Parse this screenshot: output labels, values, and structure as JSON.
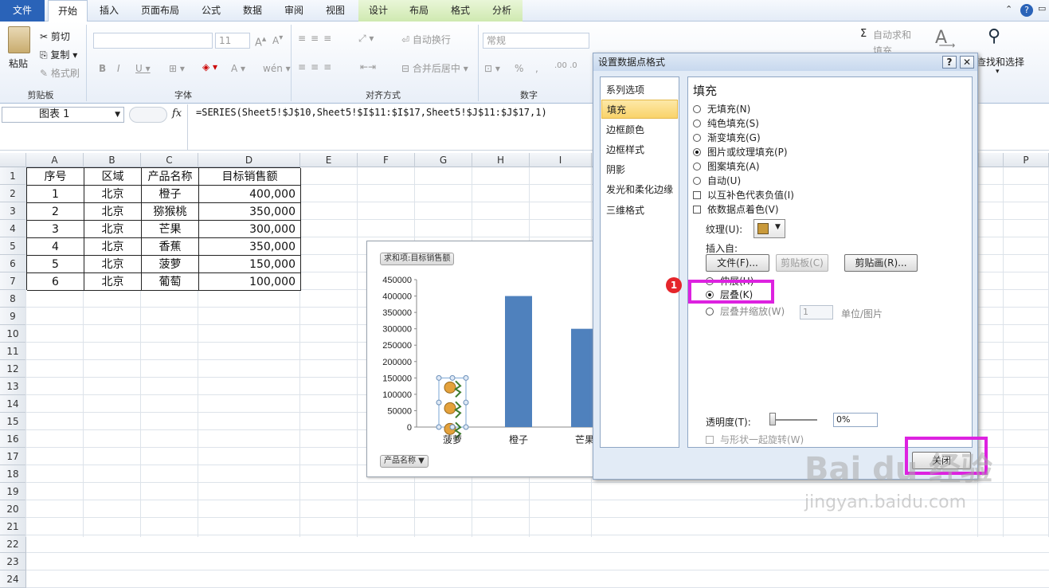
{
  "tabs": [
    "文件",
    "开始",
    "插入",
    "页面布局",
    "公式",
    "数据",
    "审阅",
    "视图",
    "设计",
    "布局",
    "格式",
    "分析"
  ],
  "ribbon": {
    "clipboard": {
      "paste": "粘贴",
      "cut": "剪切",
      "copy": "复制",
      "format_painter": "格式刷",
      "label": "剪贴板"
    },
    "font": {
      "size": "11",
      "label": "字体"
    },
    "alignment": {
      "wrap": "自动换行",
      "merge": "合并后居中",
      "label": "对齐方式"
    },
    "number": {
      "format": "常规",
      "label": "数字"
    },
    "editing": {
      "autosum": "自动求和",
      "fill": "填充",
      "find": "查找和选择"
    }
  },
  "formula_bar": {
    "name_box": "图表 1",
    "fx": "fx",
    "formula": "=SERIES(Sheet5!$J$10,Sheet5!$I$11:$I$17,Sheet5!$J$11:$J$17,1)"
  },
  "columns": [
    "A",
    "B",
    "C",
    "D",
    "E",
    "F",
    "G",
    "H",
    "I",
    "P"
  ],
  "rows": [
    "1",
    "2",
    "3",
    "4",
    "5",
    "6",
    "7",
    "8",
    "9",
    "10",
    "11",
    "12",
    "13",
    "14",
    "15",
    "16",
    "17",
    "18",
    "19",
    "20",
    "21",
    "22",
    "23",
    "24"
  ],
  "table": {
    "headers": [
      "序号",
      "区域",
      "产品名称",
      "目标销售额"
    ],
    "rows": [
      [
        "1",
        "北京",
        "橙子",
        "400,000"
      ],
      [
        "2",
        "北京",
        "猕猴桃",
        "350,000"
      ],
      [
        "3",
        "北京",
        "芒果",
        "300,000"
      ],
      [
        "4",
        "北京",
        "香蕉",
        "350,000"
      ],
      [
        "5",
        "北京",
        "菠萝",
        "150,000"
      ],
      [
        "6",
        "北京",
        "葡萄",
        "100,000"
      ]
    ]
  },
  "chart": {
    "field_button": "求和项:目标销售额",
    "axis_field_button": "产品名称"
  },
  "chart_data": {
    "type": "bar",
    "categories": [
      "菠萝",
      "橙子",
      "芒果"
    ],
    "values": [
      150000,
      400000,
      300000
    ],
    "yticks": [
      "450000",
      "400000",
      "350000",
      "300000",
      "250000",
      "200000",
      "150000",
      "100000",
      "50000",
      "0"
    ],
    "ylim": [
      0,
      450000
    ],
    "bar_color": "#4f81bd",
    "picture_fill_category": "菠萝"
  },
  "dialog": {
    "title": "设置数据点格式",
    "help": "?",
    "close_x": "✕",
    "nav": [
      "系列选项",
      "填充",
      "边框颜色",
      "边框样式",
      "阴影",
      "发光和柔化边缘",
      "三维格式"
    ],
    "selected_nav": "填充",
    "section_title": "填充",
    "fill_options": [
      "无填充(N)",
      "纯色填充(S)",
      "渐变填充(G)",
      "图片或纹理填充(P)",
      "图案填充(A)",
      "自动(U)"
    ],
    "checkboxes": [
      "以互补色代表负值(I)",
      "依数据点着色(V)"
    ],
    "texture_label": "纹理(U):",
    "insert_from": "插入自:",
    "insert_buttons": [
      "文件(F)...",
      "剪贴板(C)",
      "剪贴画(R)..."
    ],
    "stack_options": [
      "伸展(H)",
      "层叠(K)",
      "层叠并缩放(W)"
    ],
    "units_value": "1",
    "units_label": "单位/图片",
    "transparency_label": "透明度(T):",
    "transparency_value": "0%",
    "rotate_label": "与形状一起旋转(W)",
    "close_button": "关闭",
    "step_badge": "1",
    "highlight_color": "#dd22e0"
  },
  "watermark": {
    "brand": "Bai du 经验",
    "url": "jingyan.baidu.com"
  }
}
